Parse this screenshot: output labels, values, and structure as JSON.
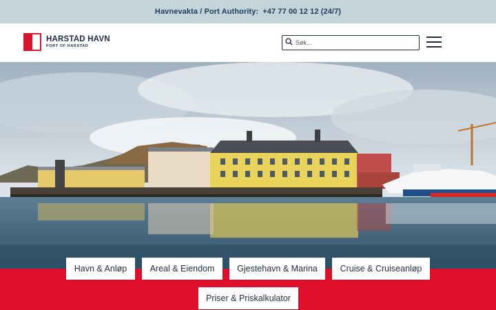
{
  "topbar": {
    "label": "Havnevakta / Port Authority:",
    "phone": "+47 77 00 12 12 (24/7)"
  },
  "header": {
    "logo_name": "HARSTAD HAVN",
    "logo_sub": "PORT OF HARSTAD",
    "search_placeholder": "Søk..."
  },
  "nav_tiles": [
    {
      "label": "Havn & Anløp"
    },
    {
      "label": "Areal & Eiendom"
    },
    {
      "label": "Gjestehavn & Marina"
    },
    {
      "label": "Cruise & Cruiseanløp"
    },
    {
      "label": "Priser & Priskalkulator"
    }
  ],
  "colors": {
    "brand_red": "#e0102b",
    "navy": "#1f2a44",
    "topbar_bg": "#c4d4db"
  },
  "icons": [
    "search-icon",
    "hamburger-menu-icon"
  ]
}
